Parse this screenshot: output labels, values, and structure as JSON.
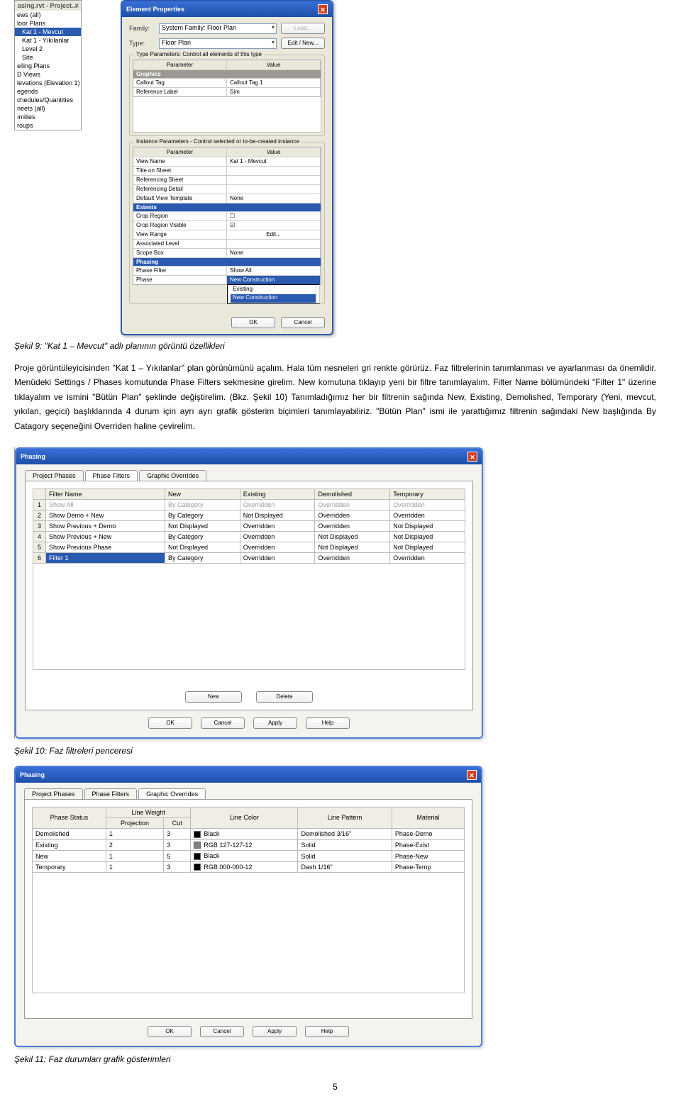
{
  "shot1": {
    "doc_header": "asing.rvt - Project...",
    "tree": [
      {
        "label": "ews (all)",
        "indent": 0
      },
      {
        "label": "loor Plans",
        "indent": 0
      },
      {
        "label": "Kat 1 - Mevcut",
        "indent": 1,
        "selected": true
      },
      {
        "label": "Kat 1 - Yıkılanlar",
        "indent": 1
      },
      {
        "label": "Level 2",
        "indent": 1
      },
      {
        "label": "Site",
        "indent": 1
      },
      {
        "label": "eiling Plans",
        "indent": 0
      },
      {
        "label": "D Views",
        "indent": 0
      },
      {
        "label": "levations (Elevation 1)",
        "indent": 0
      },
      {
        "label": "egends",
        "indent": 0
      },
      {
        "label": "chedules/Quantities",
        "indent": 0
      },
      {
        "label": "neets (all)",
        "indent": 0
      },
      {
        "label": "ımilies",
        "indent": 0
      },
      {
        "label": "roups",
        "indent": 0
      }
    ],
    "dlg_title": "Element Properties",
    "family_label": "Family:",
    "family_value": "System Family: Floor Plan",
    "load_btn": "Load...",
    "type_label": "Type:",
    "type_value": "Floor Plan",
    "edit_new_btn": "Edit / New...",
    "type_params_legend": "Type Parameters: Control all elements of this type",
    "param_col": "Parameter",
    "value_col": "Value",
    "graphics_cat": "Graphics",
    "type_rows": [
      {
        "p": "Callout Tag",
        "v": "Callout Tag 1"
      },
      {
        "p": "Reference Label",
        "v": "Sim"
      }
    ],
    "instance_legend": "Instance Parameters - Control selected or to-be-created instance",
    "inst_sections": {
      "top_rows": [
        {
          "p": "View Name",
          "v": "Kat 1 - Mevcut"
        },
        {
          "p": "Title on Sheet",
          "v": ""
        },
        {
          "p": "Referencing Sheet",
          "v": ""
        },
        {
          "p": "Referencing Detail",
          "v": ""
        },
        {
          "p": "Default View Template",
          "v": "None"
        }
      ],
      "extents_cat": "Extents",
      "extents_rows": [
        {
          "p": "Crop Region",
          "v": "☐"
        },
        {
          "p": "Crop Region Visible",
          "v": "☑"
        },
        {
          "p": "View Range",
          "v": "Edit..."
        },
        {
          "p": "Associated Level",
          "v": ""
        },
        {
          "p": "Scope Box",
          "v": "None"
        }
      ],
      "phasing_cat": "Phasing",
      "phase_filter_label": "Phase Filter",
      "phase_filter_value": "Show All",
      "phase_label": "Phase",
      "phase_value": "New Construction",
      "phase_options": [
        "Existing",
        "New Construction"
      ]
    },
    "ok_btn": "OK",
    "cancel_btn": "Cancel"
  },
  "caption1": "Şekil 9: \"Kat 1 – Mevcut\" adlı planının görüntü özellikleri",
  "para1": "Proje görüntüleyicisinden \"Kat 1 – Yıkılanlar\" plan görünümünü açalım. Hala tüm nesneleri gri renkte görürüz. Faz filtrelerinin tanımlanması ve ayarlanması da önemlidir. Menüdeki Settings / Phases komutunda Phase Filters sekmesine girelim. New komutuna tıklayıp yeni bir filtre tanımlayalım. Filter Name bölümündeki \"Filter 1\" üzerine tıklayalım ve ismini \"Bütün Plan\" şeklinde değiştirelim. (Bkz. Şekil 10) Tanımladığımız her bir filtrenin sağında New, Existing, Demolished, Temporary (Yeni, mevcut, yıkılan, geçici) başlıklarında 4 durum için ayrı ayrı grafik gösterim biçimleri tanımlayabiliriz. \"Bütün Plan\" ismi ile yarattığımız filtrenin sağındaki New başlığında By Catagory seçeneğini Overriden haline çevirelim.",
  "shot2": {
    "title": "Phasing",
    "tabs": [
      "Project Phases",
      "Phase Filters",
      "Graphic Overrides"
    ],
    "active_tab": 1,
    "cols": [
      "",
      "Filter Name",
      "New",
      "Existing",
      "Demolished",
      "Temporary"
    ],
    "rows": [
      {
        "n": "1",
        "name": "Show All",
        "new": "By Category",
        "existing": "Overridden",
        "demolished": "Overridden",
        "temporary": "Overridden",
        "dim": true
      },
      {
        "n": "2",
        "name": "Show Demo + New",
        "new": "By Category",
        "existing": "Not Displayed",
        "demolished": "Overridden",
        "temporary": "Overridden"
      },
      {
        "n": "3",
        "name": "Show Previous + Demo",
        "new": "Not Displayed",
        "existing": "Overridden",
        "demolished": "Overridden",
        "temporary": "Not Displayed"
      },
      {
        "n": "4",
        "name": "Show Previous + New",
        "new": "By Category",
        "existing": "Overridden",
        "demolished": "Not Displayed",
        "temporary": "Not Displayed"
      },
      {
        "n": "5",
        "name": "Show Previous Phase",
        "new": "Not Displayed",
        "existing": "Overridden",
        "demolished": "Not Displayed",
        "temporary": "Not Displayed"
      },
      {
        "n": "6",
        "name": "Filter 1",
        "new": "By Category",
        "existing": "Overridden",
        "demolished": "Overridden",
        "temporary": "Overridden",
        "sel_name": true
      }
    ],
    "new_btn": "New",
    "delete_btn": "Delete",
    "ok_btn": "OK",
    "cancel_btn": "Cancel",
    "apply_btn": "Apply",
    "help_btn": "Help"
  },
  "caption2": "Şekil 10: Faz filtreleri penceresi",
  "shot3": {
    "title": "Phasing",
    "tabs": [
      "Project Phases",
      "Phase Filters",
      "Graphic Overrides"
    ],
    "active_tab": 2,
    "lw_col": "Line Weight",
    "cols": {
      "phase_status": "Phase Status",
      "projection": "Projection",
      "cut": "Cut",
      "line_color": "Line Color",
      "line_pattern": "Line Pattern",
      "material": "Material"
    },
    "rows": [
      {
        "status": "Demolished",
        "proj": "1",
        "cut": "3",
        "color": "Black",
        "swatch": "black",
        "pattern": "Demolished 3/16\"",
        "material": "Phase-Demo"
      },
      {
        "status": "Existing",
        "proj": "2",
        "cut": "3",
        "color": "RGB 127-127-12",
        "swatch": "gray",
        "pattern": "Solid",
        "material": "Phase-Exist"
      },
      {
        "status": "New",
        "proj": "1",
        "cut": "5",
        "color": "Black",
        "swatch": "black",
        "pattern": "Solid",
        "material": "Phase-New"
      },
      {
        "status": "Temporary",
        "proj": "1",
        "cut": "3",
        "color": "RGB 000-000-12",
        "swatch": "black",
        "pattern": "Dash 1/16\"",
        "material": "Phase-Temp"
      }
    ],
    "ok_btn": "OK",
    "cancel_btn": "Cancel",
    "apply_btn": "Apply",
    "help_btn": "Help"
  },
  "caption3": "Şekil 11: Faz durumları grafik gösterimleri",
  "page_num": "5"
}
